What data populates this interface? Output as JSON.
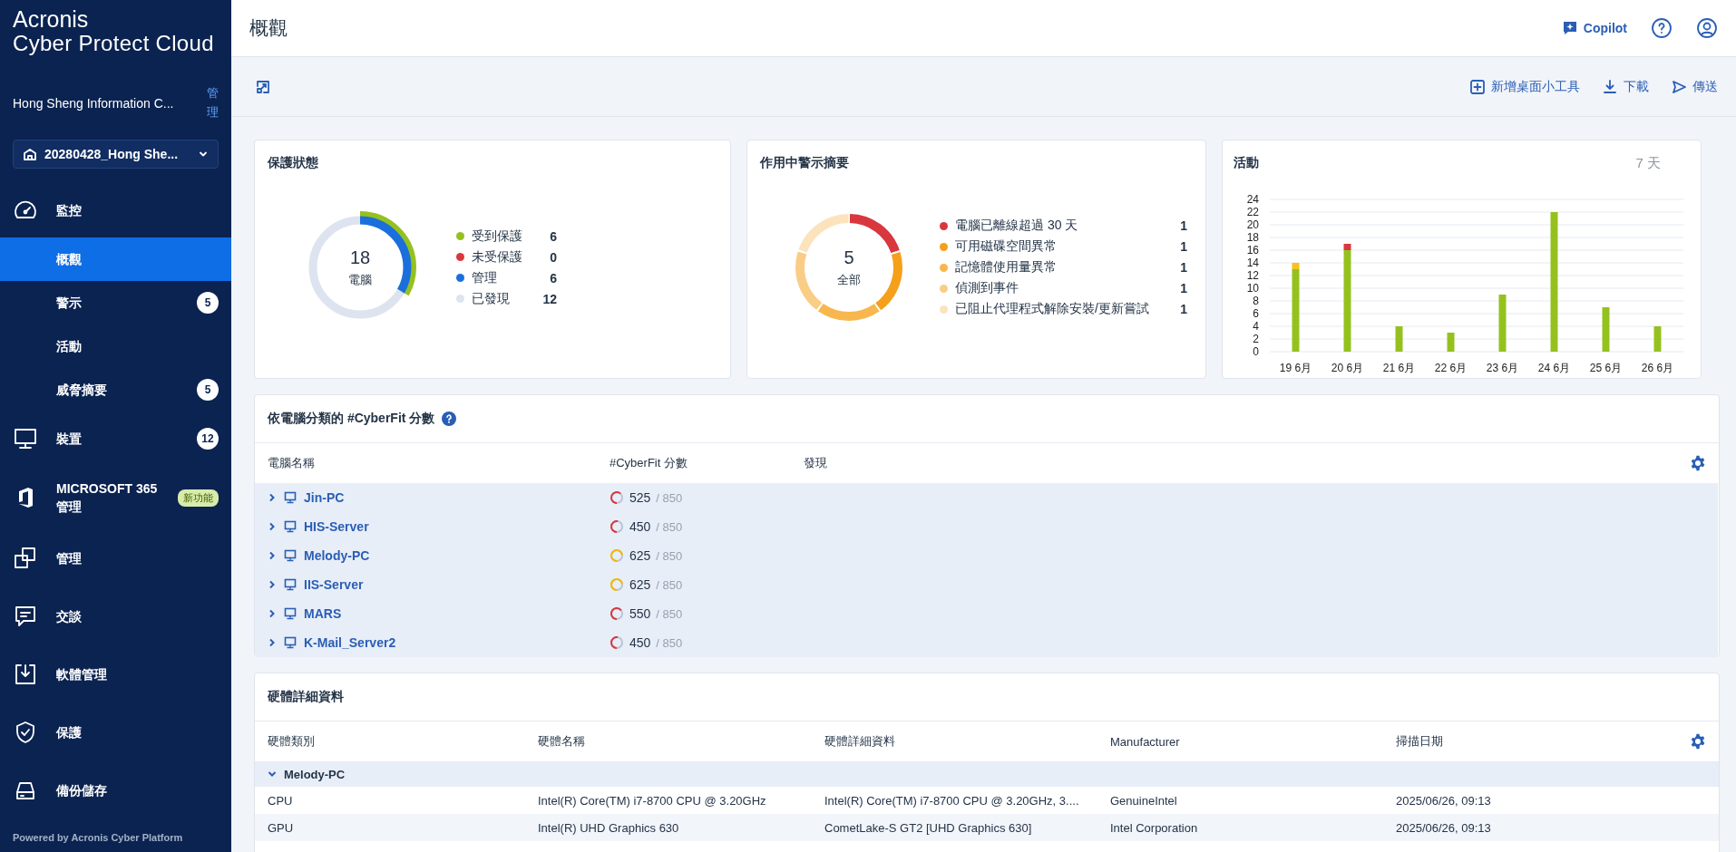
{
  "brand": {
    "line1": "Acronis",
    "line2": "Cyber Protect Cloud"
  },
  "tenant": {
    "name": "Hong Sheng Information C...",
    "manage_link": "管理"
  },
  "unit_selector": {
    "value": "20280428_Hong She..."
  },
  "nav": [
    {
      "label": "監控",
      "selected": false,
      "children": [
        {
          "label": "概觀",
          "selected": true
        },
        {
          "label": "警示",
          "badge": "5",
          "selected": false
        },
        {
          "label": "活動",
          "selected": false
        },
        {
          "label": "威脅摘要",
          "badge": "5",
          "selected": false
        }
      ]
    },
    {
      "label": "裝置",
      "badge": "12",
      "selected": false
    },
    {
      "label": "MICROSOFT 365",
      "sublabel": "管理",
      "tag": "新功能",
      "selected": false
    },
    {
      "label": "管理",
      "selected": false
    },
    {
      "label": "交談",
      "selected": false
    },
    {
      "label": "軟體管理",
      "selected": false
    },
    {
      "label": "保護",
      "selected": false
    },
    {
      "label": "備份儲存",
      "selected": false
    }
  ],
  "footer": "Powered by Acronis Cyber Platform",
  "header": {
    "title": "概觀",
    "copilot": "Copilot"
  },
  "toolbar": {
    "add_widget": "新增桌面小工具",
    "download": "下載",
    "send": "傳送"
  },
  "protection": {
    "title": "保護狀態",
    "total": "18",
    "total_label": "電腦",
    "items": [
      {
        "label": "受到保護",
        "count": "6",
        "color": "#95c11f"
      },
      {
        "label": "未受保護",
        "count": "0",
        "color": "#d9373e"
      },
      {
        "label": "管理",
        "count": "6",
        "color": "#1a6fdc"
      },
      {
        "label": "已發現",
        "count": "12",
        "color": "#dde4ef"
      }
    ]
  },
  "alerts": {
    "title": "作用中警示摘要",
    "total": "5",
    "total_label": "全部",
    "items": [
      {
        "label": "電腦已離線超過 30 天",
        "count": "1",
        "color": "#d9373e"
      },
      {
        "label": "可用磁碟空間異常",
        "count": "1",
        "color": "#f59f1a"
      },
      {
        "label": "記憶體使用量異常",
        "count": "1",
        "color": "#f7b74e"
      },
      {
        "label": "偵測到事件",
        "count": "1",
        "color": "#f9cd85"
      },
      {
        "label": "已阻止代理程式解除安裝/更新嘗試",
        "count": "1",
        "color": "#fde3bd"
      }
    ]
  },
  "activity": {
    "title": "活動",
    "period": "7 天",
    "chart_data": {
      "type": "bar",
      "stacked": true,
      "grid": true,
      "categories": [
        "19 6月",
        "20 6月",
        "21 6月",
        "22 6月",
        "23 6月",
        "24 6月",
        "25 6月",
        "26 6月"
      ],
      "series": [
        {
          "color": "#95c11f",
          "values": [
            13,
            16,
            4,
            3,
            9,
            22,
            7,
            4
          ]
        },
        {
          "color": "#f8c21c",
          "values": [
            1,
            0,
            0,
            0,
            0,
            0,
            0,
            0
          ]
        },
        {
          "color": "#d9373e",
          "values": [
            0,
            1,
            0,
            0,
            0,
            0,
            0,
            0
          ]
        }
      ],
      "ylim": [
        0,
        24
      ],
      "yticks": [
        0,
        2,
        4,
        6,
        8,
        10,
        12,
        14,
        16,
        18,
        20,
        22,
        24
      ]
    }
  },
  "cyberfit": {
    "title": "依電腦分類的 #CyberFit 分數",
    "columns": [
      "電腦名稱",
      "#CyberFit 分數",
      "發現"
    ],
    "rows": [
      {
        "name": "Jin-PC",
        "score": "525",
        "max": "/ 850",
        "color": "#d9373e",
        "expanded": false
      },
      {
        "name": "HIS-Server",
        "score": "450",
        "max": "/ 850",
        "color": "#d9373e",
        "expanded": false
      },
      {
        "name": "Melody-PC",
        "score": "625",
        "max": "/ 850",
        "color": "#f5b800",
        "expanded": false
      },
      {
        "name": "IIS-Server",
        "score": "625",
        "max": "/ 850",
        "color": "#f5b800",
        "expanded": false
      },
      {
        "name": "MARS",
        "score": "550",
        "max": "/ 850",
        "color": "#d9373e",
        "expanded": false
      },
      {
        "name": "K-Mail_Server2",
        "score": "450",
        "max": "/ 850",
        "color": "#d9373e",
        "expanded": false
      }
    ]
  },
  "hardware": {
    "title": "硬體詳細資料",
    "columns": [
      "硬體類別",
      "硬體名稱",
      "硬體詳細資料",
      "Manufacturer",
      "掃描日期"
    ],
    "groups": [
      {
        "name": "Melody-PC",
        "expanded": true,
        "rows": [
          [
            "CPU",
            "Intel(R) Core(TM) i7-8700 CPU @ 3.20GHz",
            "Intel(R) Core(TM) i7-8700 CPU @ 3.20GHz, 3....",
            "GenuineIntel",
            "2025/06/26, 09:13"
          ],
          [
            "GPU",
            "Intel(R) UHD Graphics 630",
            "CometLake-S GT2 [UHD Graphics 630]",
            "Intel Corporation",
            "2025/06/26, 09:13"
          ]
        ]
      }
    ]
  }
}
